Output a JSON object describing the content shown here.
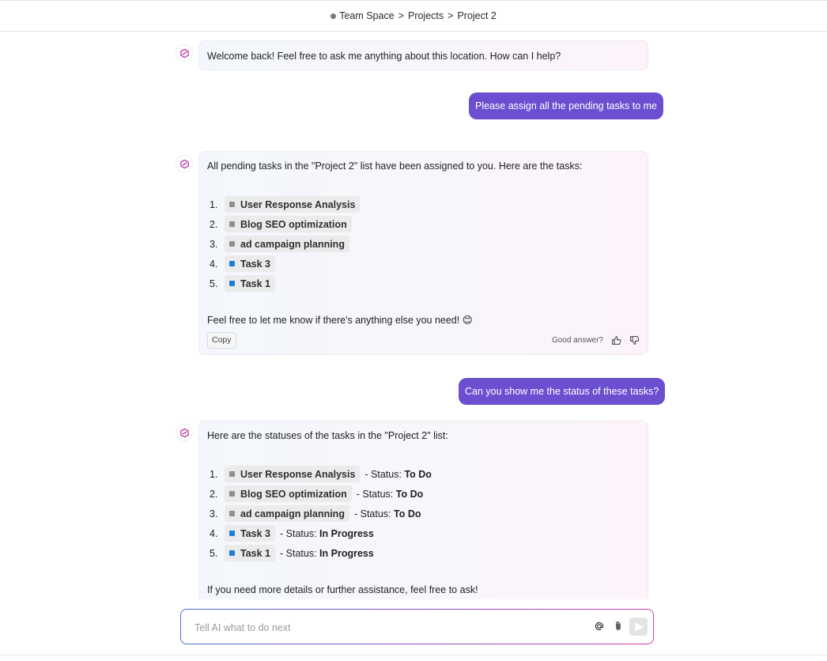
{
  "breadcrumb": [
    "Team Space",
    "Projects",
    "Project 2"
  ],
  "breadcrumb_separator": ">",
  "colors": {
    "user_bubble": "#6b4fd0",
    "task_gray": "#8f8f8f",
    "task_blue": "#1e7fd6",
    "ai_logo": "#c43dab"
  },
  "messages": [
    {
      "role": "ai",
      "text": "Welcome back! Feel free to ask me anything about this location. How can I help?"
    },
    {
      "role": "user",
      "text": "Please assign all the pending tasks to me"
    },
    {
      "role": "ai",
      "intro": "All pending tasks in the \"Project 2\" list have been assigned to you. Here are the tasks:",
      "tasks": [
        {
          "num": "1.",
          "name": "User Response Analysis",
          "color": "gray"
        },
        {
          "num": "2.",
          "name": "Blog SEO optimization",
          "color": "gray"
        },
        {
          "num": "3.",
          "name": "ad campaign planning",
          "color": "gray"
        },
        {
          "num": "4.",
          "name": "Task 3",
          "color": "blue"
        },
        {
          "num": "5.",
          "name": "Task 1",
          "color": "blue"
        }
      ],
      "outro": "Feel free to let me know if there's anything else you need! 😊",
      "copy_label": "Copy",
      "feedback_label": "Good answer?"
    },
    {
      "role": "user",
      "text": "Can you show me the status of these tasks?"
    },
    {
      "role": "ai",
      "intro": "Here are the statuses of the tasks in the \"Project 2\" list:",
      "status_prefix": "- Status:",
      "tasks": [
        {
          "num": "1.",
          "name": "User Response Analysis",
          "color": "gray",
          "status": "To Do"
        },
        {
          "num": "2.",
          "name": "Blog SEO optimization",
          "color": "gray",
          "status": "To Do"
        },
        {
          "num": "3.",
          "name": "ad campaign planning",
          "color": "gray",
          "status": "To Do"
        },
        {
          "num": "4.",
          "name": "Task 3",
          "color": "blue",
          "status": "In Progress"
        },
        {
          "num": "5.",
          "name": "Task 1",
          "color": "blue",
          "status": "In Progress"
        }
      ],
      "outro": "If you need more details or further assistance, feel free to ask!"
    }
  ],
  "composer": {
    "placeholder": "Tell AI what to do next",
    "icons": [
      "at-icon",
      "paperclip-icon",
      "send-icon"
    ]
  }
}
